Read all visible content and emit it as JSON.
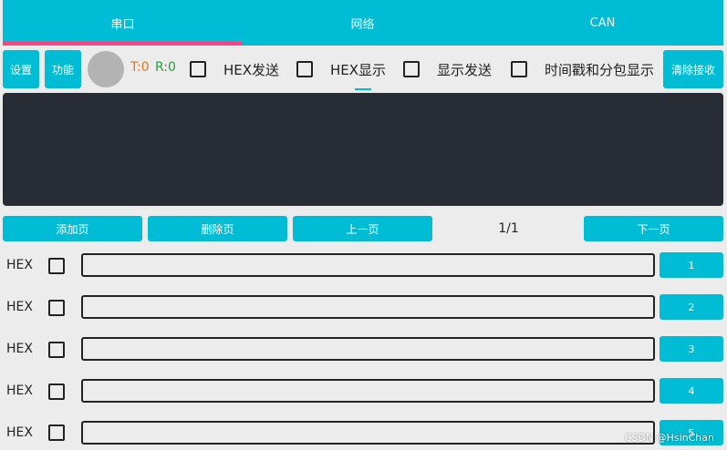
{
  "tabs": [
    {
      "label": "串口",
      "active": true
    },
    {
      "label": "网络",
      "active": false
    },
    {
      "label": "CAN",
      "active": false
    }
  ],
  "toolbar": {
    "settings_label": "设置",
    "function_label": "功能",
    "tx_count": "T:0",
    "rx_count": "R:0",
    "hex_send_label": "HEX发送",
    "hex_display_label": "HEX显示",
    "show_send_label": "显示发送",
    "timestamp_label": "时间戳和分包显示",
    "clear_label": "清除接收"
  },
  "pager": {
    "add_label": "添加页",
    "delete_label": "删除页",
    "prev_label": "上一页",
    "indicator": "1/1",
    "next_label": "下一页"
  },
  "send_rows": [
    {
      "hex_label": "HEX",
      "value": "",
      "button": "1"
    },
    {
      "hex_label": "HEX",
      "value": "",
      "button": "2"
    },
    {
      "hex_label": "HEX",
      "value": "",
      "button": "3"
    },
    {
      "hex_label": "HEX",
      "value": "",
      "button": "4"
    },
    {
      "hex_label": "HEX",
      "value": "",
      "button": "5"
    }
  ],
  "watermark": "CSDN @HsinChan",
  "colors": {
    "accent": "#00bcd4",
    "indicator": "#ff4081",
    "receive_bg": "#282c34",
    "tx_color": "#e8751a",
    "rx_color": "#2e9a3e"
  }
}
